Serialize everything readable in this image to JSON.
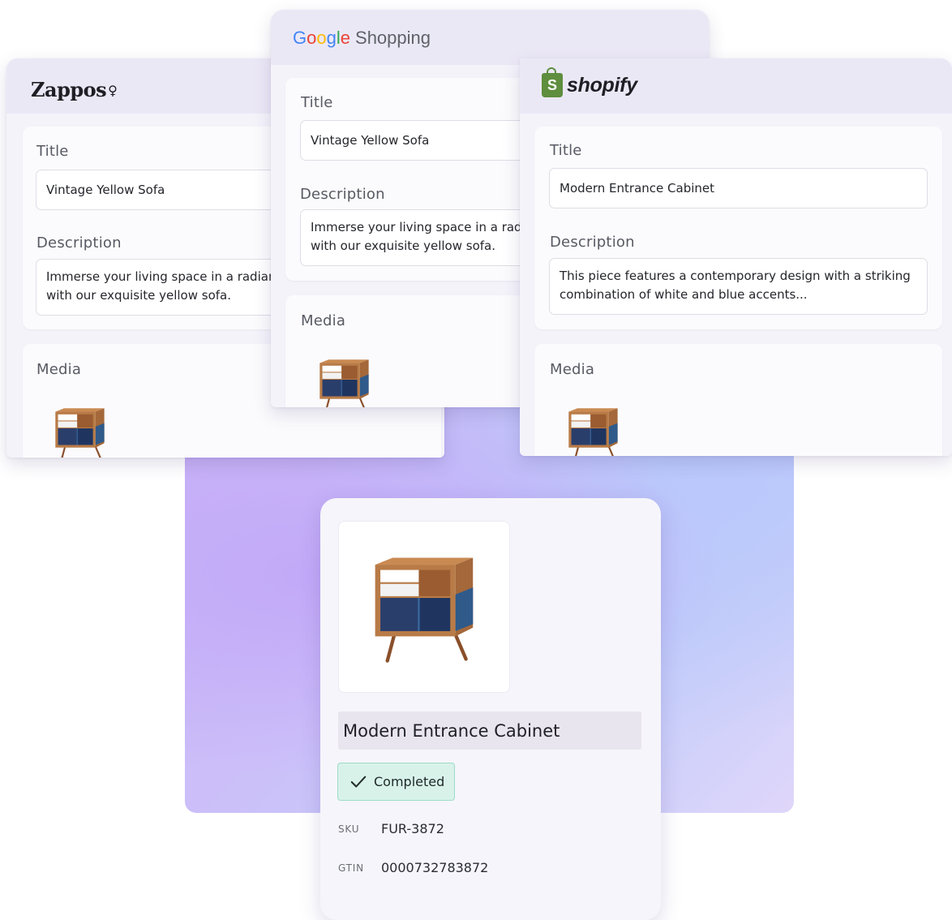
{
  "zappos": {
    "brand": "Zappos",
    "brand_mark": "♀",
    "title_label": "Title",
    "title_value": "Vintage Yellow Sofa",
    "description_label": "Description",
    "description_value": "Immerse your living space in a radian\nwith our exquisite yellow sofa.",
    "media_label": "Media"
  },
  "google": {
    "brand_letters": [
      "G",
      "o",
      "o",
      "g",
      "l",
      "e"
    ],
    "brand_suffix": "Shopping",
    "title_label": "Title",
    "title_value": "Vintage Yellow Sofa",
    "description_label": "Description",
    "description_value": "Immerse your living space in a radi\nwith our exquisite yellow sofa.",
    "media_label": "Media"
  },
  "shopify": {
    "bag_letter": "S",
    "brand": "shopify",
    "title_label": "Title",
    "title_value": "Modern Entrance Cabinet",
    "description_label": "Description",
    "description_value": "This piece features a contemporary design with a striking\ncombination of white and blue accents...",
    "media_label": "Media"
  },
  "product": {
    "name": "Modern Entrance Cabinet",
    "status": "Completed",
    "status_icon": "check-icon",
    "sku_label": "SKU",
    "sku_value": "FUR-3872",
    "gtin_label": "GTIN",
    "gtin_value": "0000732783872"
  },
  "colors": {
    "status_bg": "#d8f2ea",
    "status_border": "#9fdcc6",
    "shopify_green": "#5e8e3e",
    "google_blue": "#4285f4",
    "google_red": "#ea4335",
    "google_yellow": "#fbbc05",
    "google_green": "#34a853"
  }
}
